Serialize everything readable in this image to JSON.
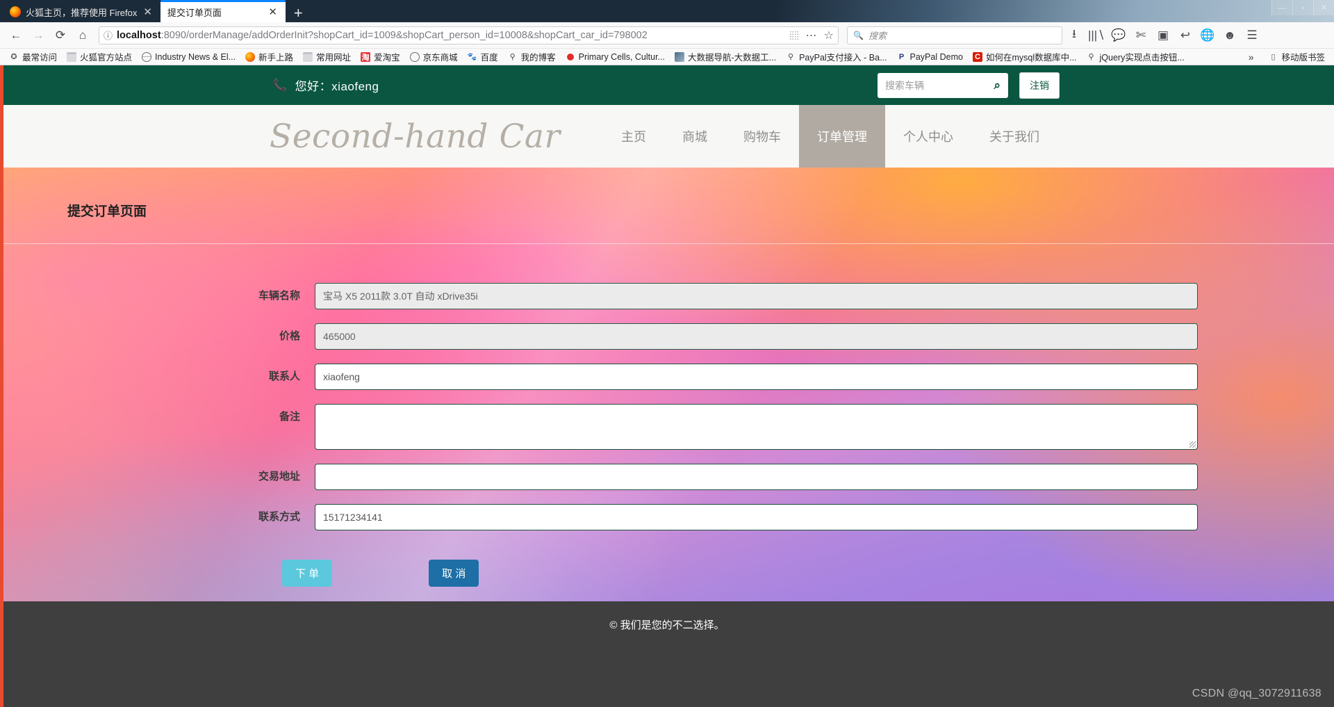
{
  "browser": {
    "tabs": [
      {
        "title": "火狐主页，推荐使用 Firefox",
        "close": "✕",
        "active": false
      },
      {
        "title": "提交订单页面",
        "close": "✕",
        "active": true
      }
    ],
    "newtab_label": "+",
    "window_controls": {
      "minimize": "—",
      "maximize": "▫",
      "close": "✕"
    },
    "nav": {
      "back": "←",
      "forward": "→",
      "reload": "⟳",
      "home": "⌂",
      "info_icon": "ⓘ",
      "url_host": "localhost",
      "url_rest": ":8090/orderManage/addOrderInit?shopCart_id=1009&shopCart_person_id=10008&shopCart_car_id=798002",
      "reader_icon": "⋯",
      "star_icon": "☆",
      "search_placeholder": "搜索",
      "search_icon": "🔍",
      "download_icon": "⭳",
      "library_icon": "|||∖",
      "sync_icon": "💬",
      "screenshot_icon": "✄",
      "sidebar_icon": "▣",
      "undo_icon": "↩",
      "globe_icon": "🌐",
      "account_icon": "☻",
      "menu_icon": "☰"
    },
    "bookmarks": [
      {
        "label": "最常访问",
        "icon": "ico-star",
        "glyph": "✪"
      },
      {
        "label": "火狐官方站点",
        "icon": "ico-folder",
        "glyph": ""
      },
      {
        "label": "Industry News & El...",
        "icon": "ico-globe",
        "glyph": ""
      },
      {
        "label": "新手上路",
        "icon": "ico-ff",
        "glyph": ""
      },
      {
        "label": "常用网址",
        "icon": "ico-folder",
        "glyph": ""
      },
      {
        "label": "爱淘宝",
        "icon": "ico-tb",
        "glyph": "淘"
      },
      {
        "label": "京东商城",
        "icon": "ico-jd",
        "glyph": ""
      },
      {
        "label": "百度",
        "icon": "ico-baidu",
        "glyph": "🐾"
      },
      {
        "label": "我的博客",
        "icon": "ico-blog",
        "glyph": "⚲"
      },
      {
        "label": "Primary Cells, Cultur...",
        "icon": "ico-red",
        "glyph": ""
      },
      {
        "label": "大数据导航-大数据工...",
        "icon": "ico-bigdata",
        "glyph": ""
      },
      {
        "label": "PayPal支付接入 - Ba...",
        "icon": "ico-blog",
        "glyph": "⚲"
      },
      {
        "label": "PayPal Demo",
        "icon": "ico-paypal",
        "glyph": "P"
      },
      {
        "label": "如何在mysql数据库中...",
        "icon": "ico-csdn",
        "glyph": "C"
      },
      {
        "label": "jQuery实现点击按钮...",
        "icon": "ico-blog",
        "glyph": "⚲"
      }
    ],
    "bookmarks_overflow": "»",
    "mobile_bookmarks": {
      "label": "移动版书签",
      "glyph": "▯"
    }
  },
  "site": {
    "topbar": {
      "phone_icon": "📞",
      "greeting": "您好：xiaofeng",
      "search_placeholder": "搜索车辆",
      "search_icon": "⌕",
      "logout_label": "注销"
    },
    "logo": "Second-hand Car",
    "menu": [
      {
        "label": "主页",
        "active": false
      },
      {
        "label": "商城",
        "active": false
      },
      {
        "label": "购物车",
        "active": false
      },
      {
        "label": "订单管理",
        "active": true
      },
      {
        "label": "个人中心",
        "active": false
      },
      {
        "label": "关于我们",
        "active": false
      }
    ],
    "page_title": "提交订单页面",
    "form": {
      "fields": [
        {
          "label": "车辆名称",
          "value": "宝马 X5 2011款 3.0T 自动 xDrive35i",
          "readonly": true,
          "type": "text"
        },
        {
          "label": "价格",
          "value": "465000",
          "readonly": true,
          "type": "text"
        },
        {
          "label": "联系人",
          "value": "xiaofeng",
          "readonly": false,
          "type": "text"
        },
        {
          "label": "备注",
          "value": "",
          "readonly": false,
          "type": "textarea"
        },
        {
          "label": "交易地址",
          "value": "",
          "readonly": false,
          "type": "text"
        },
        {
          "label": "联系方式",
          "value": "15171234141",
          "readonly": false,
          "type": "text"
        }
      ],
      "submit_label": "下 单",
      "cancel_label": "取 消"
    },
    "footer_text": "© 我们是您的不二选择。"
  },
  "watermark": "CSDN @qq_3072911638",
  "colors": {
    "brand_green": "#0a5640",
    "nav_active": "#b1aaa3",
    "submit": "#5bc8dd",
    "cancel": "#1d6fa5",
    "footer": "#3f3f3f"
  }
}
